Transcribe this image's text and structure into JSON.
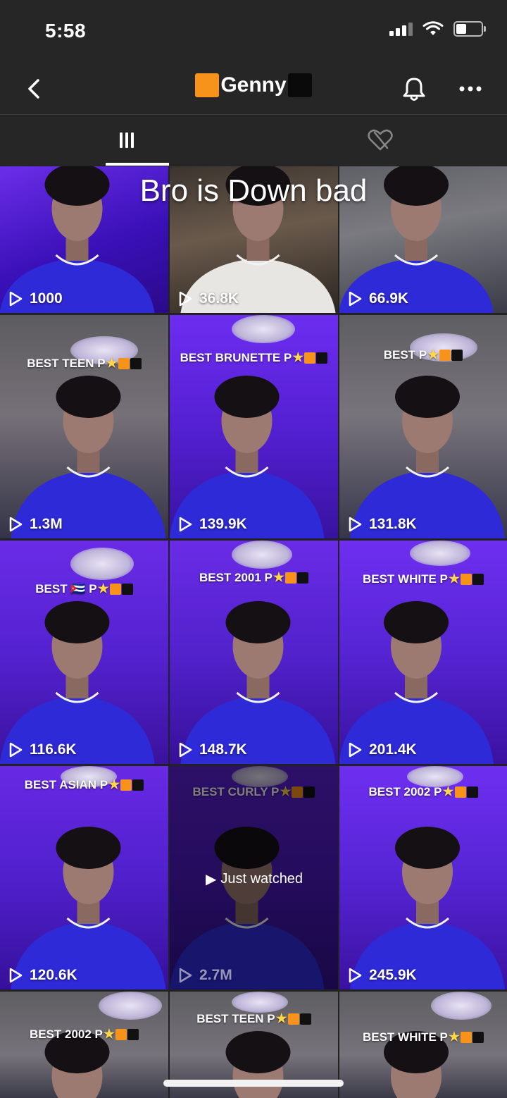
{
  "status_bar": {
    "time": "5:58"
  },
  "header": {
    "title": "Genny",
    "back_icon": "chevron-left-icon",
    "bell_icon": "bell-icon",
    "more_icon": "more-horizontal-icon"
  },
  "tabs": [
    {
      "name": "videos",
      "icon": "grid-icon",
      "selected": true
    },
    {
      "name": "liked",
      "icon": "heart-slash-icon",
      "selected": false
    }
  ],
  "overlay_caption": "Bro is Down bad",
  "videos": [
    {
      "views": "1000",
      "caption": ""
    },
    {
      "views": "36.8K",
      "caption": ""
    },
    {
      "views": "66.9K",
      "caption": ""
    },
    {
      "views": "1.3M",
      "caption": "BEST TEEN P"
    },
    {
      "views": "139.9K",
      "caption": "BEST BRUNETTE P"
    },
    {
      "views": "131.8K",
      "caption": "BEST P"
    },
    {
      "views": "116.6K",
      "caption": "BEST 🇨🇺 P"
    },
    {
      "views": "148.7K",
      "caption": "BEST 2001 P"
    },
    {
      "views": "201.4K",
      "caption": "BEST WHITE P"
    },
    {
      "views": "120.6K",
      "caption": "BEST ASIAN P"
    },
    {
      "views": "2.7M",
      "caption": "BEST CURLY P",
      "status": "Just watched"
    },
    {
      "views": "245.9K",
      "caption": "BEST 2002 P"
    },
    {
      "views": "",
      "caption": "BEST 2002 P"
    },
    {
      "views": "",
      "caption": "BEST TEEN P"
    },
    {
      "views": "",
      "caption": "BEST WHITE P"
    }
  ],
  "colors": {
    "background": "#222222",
    "purple": "#5a1fd6",
    "accent_orange": "#f7931a"
  }
}
